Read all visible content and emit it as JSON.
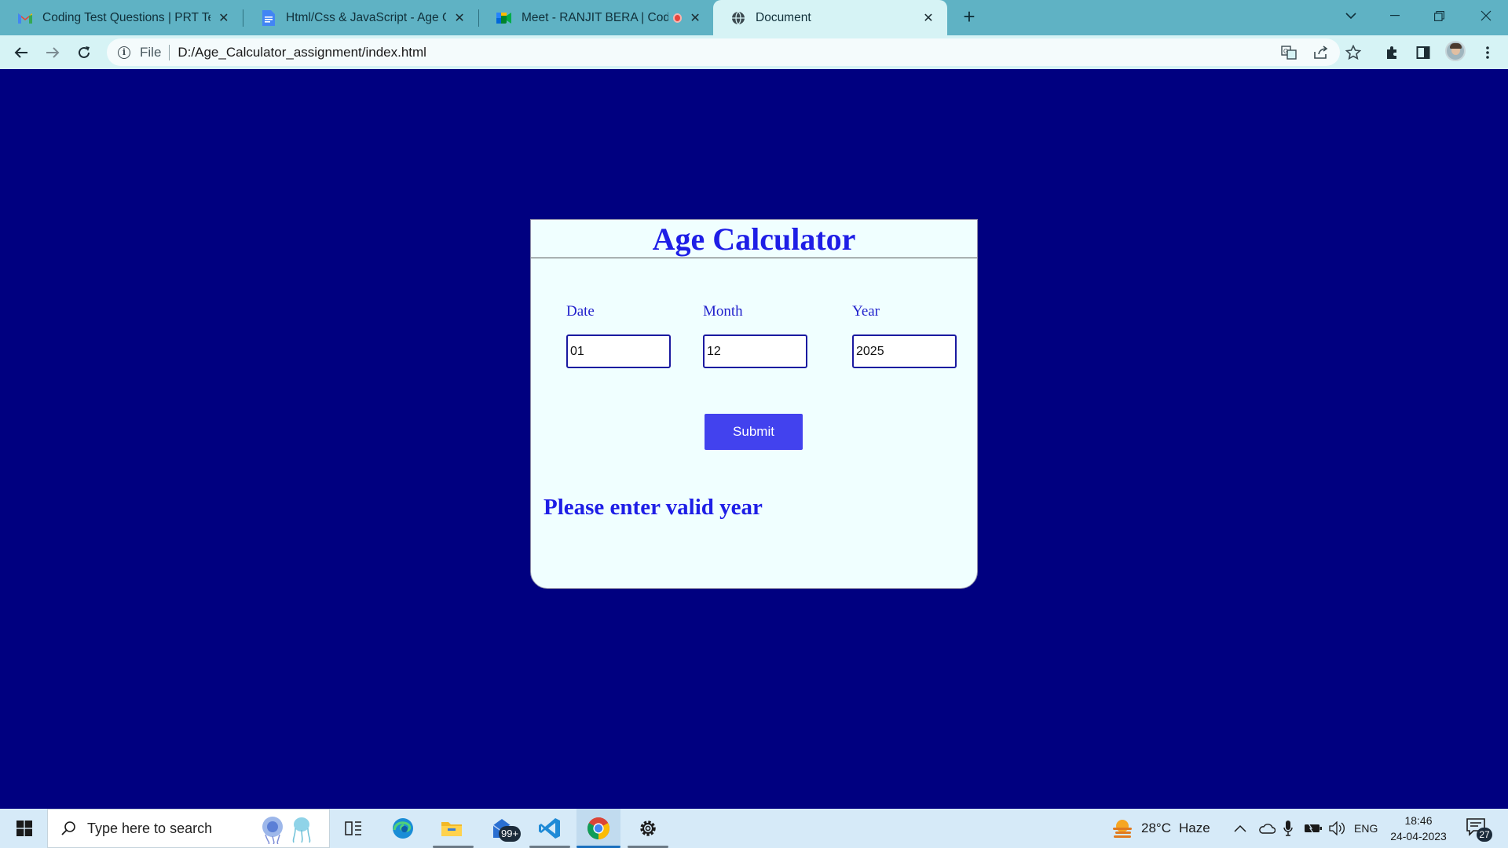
{
  "browser": {
    "tabs": [
      {
        "title": "Coding Test Questions | PRT Test",
        "icon": "gmail-icon",
        "active": false
      },
      {
        "title": "Html/Css & JavaScript - Age Calc",
        "icon": "google-docs-icon",
        "active": false
      },
      {
        "title": "Meet - RANJIT BERA | Coding",
        "icon": "google-meet-icon",
        "active": false,
        "recording": true
      },
      {
        "title": "Document",
        "icon": "globe-icon",
        "active": true
      }
    ],
    "address": {
      "scheme": "File",
      "url": "D:/Age_Calculator_assignment/index.html"
    },
    "colors": {
      "tabstrip": "#5fb2c4",
      "toolbar": "#d6f3f5"
    }
  },
  "page": {
    "background": "#000080",
    "title": "Age Calculator",
    "fields": [
      {
        "label": "Date",
        "value": "01"
      },
      {
        "label": "Month",
        "value": "12"
      },
      {
        "label": "Year",
        "value": "2025"
      }
    ],
    "submit_label": "Submit",
    "result_text": "Please enter valid year",
    "accent": "#4242ee"
  },
  "taskbar": {
    "search_placeholder": "Type here to search",
    "mail_badge": "99+",
    "weather": {
      "temp": "28°C",
      "condition": "Haze"
    },
    "language": "ENG",
    "time": "18:46",
    "date": "24-04-2023",
    "notification_count": "27"
  }
}
